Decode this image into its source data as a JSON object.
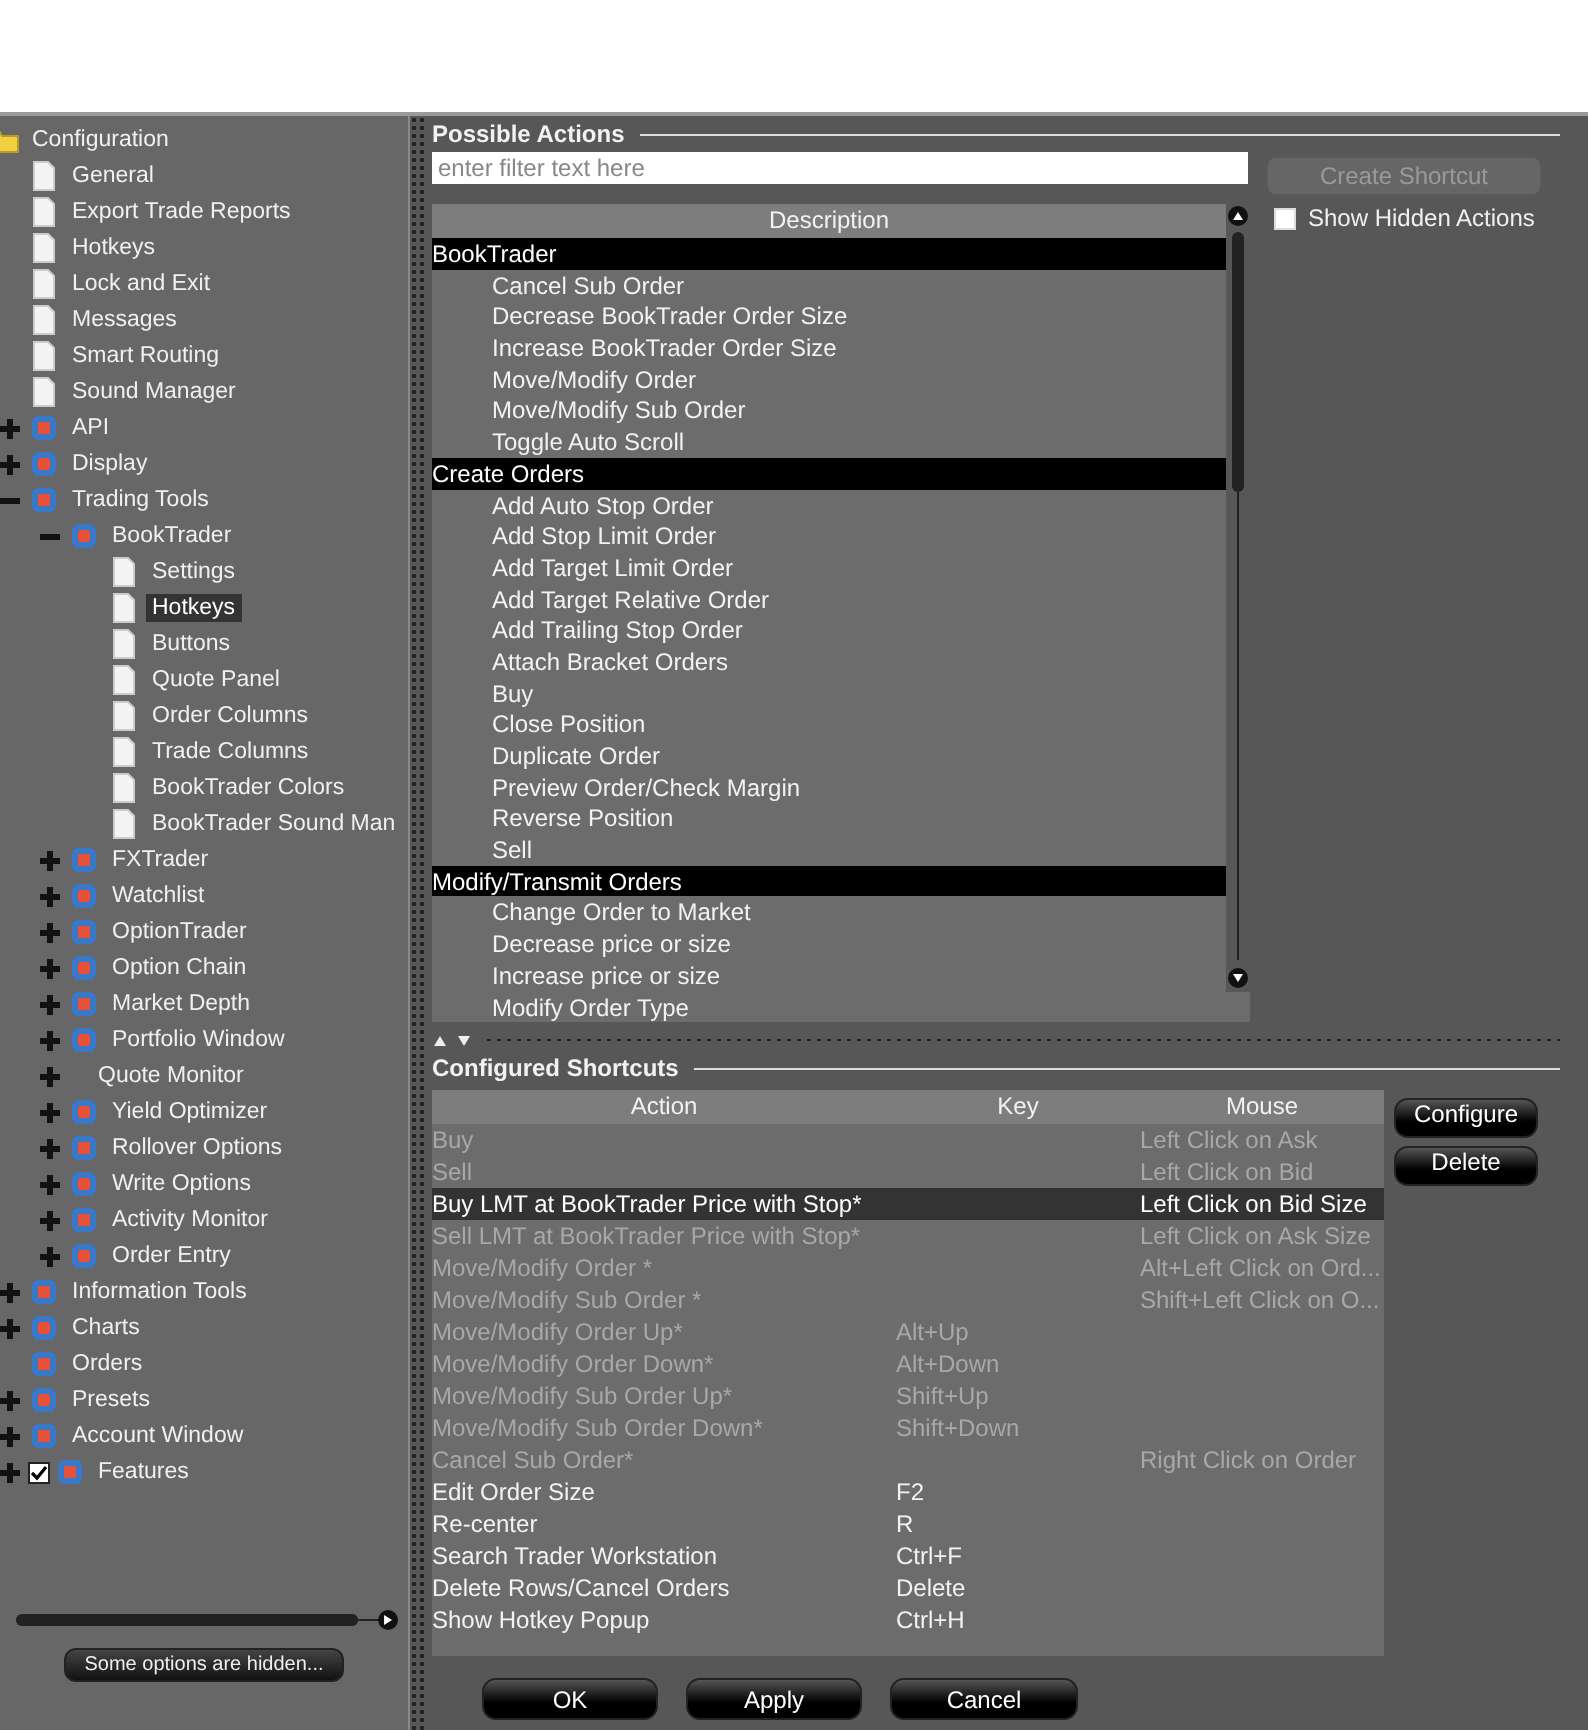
{
  "tree": {
    "items": [
      {
        "label": "Configuration",
        "kind": "folder",
        "selected": false,
        "children": [
          {
            "label": "General",
            "kind": "page",
            "selected": false
          },
          {
            "label": "Export Trade Reports",
            "kind": "page",
            "selected": false
          },
          {
            "label": "Hotkeys",
            "kind": "page",
            "selected": false
          },
          {
            "label": "Lock and Exit",
            "kind": "page",
            "selected": false
          },
          {
            "label": "Messages",
            "kind": "page",
            "selected": false
          },
          {
            "label": "Smart Routing",
            "kind": "page",
            "selected": false
          },
          {
            "label": "Sound Manager",
            "kind": "page",
            "selected": false
          },
          {
            "label": "API",
            "kind": "app",
            "expanded": false,
            "selected": false
          },
          {
            "label": "Display",
            "kind": "app",
            "expanded": false,
            "selected": false
          },
          {
            "label": "Trading Tools",
            "kind": "app",
            "expanded": true,
            "selected": false,
            "children": [
              {
                "label": "BookTrader",
                "kind": "app",
                "expanded": true,
                "selected": false,
                "children": [
                  {
                    "label": "Settings",
                    "kind": "page",
                    "selected": false
                  },
                  {
                    "label": "Hotkeys",
                    "kind": "page",
                    "selected": true
                  },
                  {
                    "label": "Buttons",
                    "kind": "page",
                    "selected": false
                  },
                  {
                    "label": "Quote Panel",
                    "kind": "page",
                    "selected": false
                  },
                  {
                    "label": "Order Columns",
                    "kind": "page",
                    "selected": false
                  },
                  {
                    "label": "Trade Columns",
                    "kind": "page",
                    "selected": false
                  },
                  {
                    "label": "BookTrader Colors",
                    "kind": "page",
                    "selected": false
                  },
                  {
                    "label": "BookTrader Sound Man",
                    "kind": "page",
                    "selected": false
                  }
                ]
              },
              {
                "label": "FXTrader",
                "kind": "app",
                "expanded": false,
                "selected": false
              },
              {
                "label": "Watchlist",
                "kind": "app",
                "expanded": false,
                "selected": false
              },
              {
                "label": "OptionTrader",
                "kind": "app",
                "expanded": false,
                "selected": false
              },
              {
                "label": "Option Chain",
                "kind": "app",
                "expanded": false,
                "selected": false
              },
              {
                "label": "Market Depth",
                "kind": "app",
                "expanded": false,
                "selected": false
              },
              {
                "label": "Portfolio Window",
                "kind": "app",
                "expanded": false,
                "selected": false
              },
              {
                "label": "Quote Monitor",
                "kind": "none",
                "expanded": false,
                "selected": false
              },
              {
                "label": "Yield Optimizer",
                "kind": "app",
                "expanded": false,
                "selected": false
              },
              {
                "label": "Rollover Options",
                "kind": "app",
                "expanded": false,
                "selected": false
              },
              {
                "label": "Write Options",
                "kind": "app",
                "expanded": false,
                "selected": false
              },
              {
                "label": "Activity Monitor",
                "kind": "app",
                "expanded": false,
                "selected": false
              },
              {
                "label": "Order Entry",
                "kind": "app",
                "expanded": false,
                "selected": false
              }
            ]
          },
          {
            "label": "Information Tools",
            "kind": "app",
            "expanded": false,
            "selected": false
          },
          {
            "label": "Charts",
            "kind": "app",
            "expanded": false,
            "selected": false
          },
          {
            "label": "Orders",
            "kind": "app",
            "selected": false
          },
          {
            "label": "Presets",
            "kind": "app",
            "expanded": false,
            "selected": false
          },
          {
            "label": "Account Window",
            "kind": "app",
            "expanded": false,
            "selected": false
          },
          {
            "label": "Features",
            "kind": "app",
            "expanded": false,
            "checked": true,
            "selected": false
          }
        ]
      }
    ]
  },
  "hidden_notice": "Some options are hidden...",
  "possible_actions": {
    "title": "Possible Actions",
    "filter": {
      "placeholder": "enter filter text here"
    },
    "create_button": {
      "label": "Create Shortcut",
      "disabled": true
    },
    "show_hidden": {
      "label": "Show Hidden Actions",
      "checked": false
    },
    "column": "Description",
    "rows": [
      {
        "kind": "group",
        "label": "BookTrader"
      },
      {
        "kind": "action",
        "label": "Cancel Sub Order"
      },
      {
        "kind": "action",
        "label": "Decrease BookTrader Order Size"
      },
      {
        "kind": "action",
        "label": "Increase BookTrader Order Size"
      },
      {
        "kind": "action",
        "label": "Move/Modify Order"
      },
      {
        "kind": "action",
        "label": "Move/Modify Sub Order"
      },
      {
        "kind": "action",
        "label": "Toggle Auto Scroll"
      },
      {
        "kind": "group",
        "label": "Create Orders"
      },
      {
        "kind": "action",
        "label": "Add Auto Stop Order"
      },
      {
        "kind": "action",
        "label": "Add Stop Limit Order"
      },
      {
        "kind": "action",
        "label": "Add Target Limit Order"
      },
      {
        "kind": "action",
        "label": "Add Target Relative Order"
      },
      {
        "kind": "action",
        "label": "Add Trailing Stop Order"
      },
      {
        "kind": "action",
        "label": "Attach Bracket Orders"
      },
      {
        "kind": "action",
        "label": "Buy"
      },
      {
        "kind": "action",
        "label": "Close Position"
      },
      {
        "kind": "action",
        "label": "Duplicate Order"
      },
      {
        "kind": "action",
        "label": "Preview Order/Check Margin"
      },
      {
        "kind": "action",
        "label": "Reverse Position"
      },
      {
        "kind": "action",
        "label": "Sell"
      },
      {
        "kind": "group",
        "label": "Modify/Transmit Orders"
      },
      {
        "kind": "action",
        "label": "Change Order to Market"
      },
      {
        "kind": "action",
        "label": "Decrease price or size"
      },
      {
        "kind": "action",
        "label": "Increase price or size"
      },
      {
        "kind": "action",
        "label": "Modify Order Type"
      }
    ]
  },
  "configured_shortcuts": {
    "title": "Configured Shortcuts",
    "columns": [
      "Action",
      "Key",
      "Mouse"
    ],
    "rows": [
      {
        "action": "Buy",
        "mouse": "Left Click on Ask",
        "disabled": true,
        "selected": false
      },
      {
        "action": "Sell",
        "mouse": "Left Click on Bid",
        "disabled": true,
        "selected": false
      },
      {
        "action": "Buy LMT at BookTrader Price with Stop*",
        "mouse": "Left Click on Bid Size",
        "disabled": true,
        "selected": true
      },
      {
        "action": "Sell LMT at BookTrader Price with Stop*",
        "mouse": "Left Click on Ask Size",
        "disabled": true,
        "selected": false
      },
      {
        "action": "Move/Modify Order *",
        "mouse": "Alt+Left Click on Ord...",
        "disabled": true,
        "selected": false
      },
      {
        "action": "Move/Modify Sub Order *",
        "mouse": "Shift+Left Click on O...",
        "disabled": true,
        "selected": false
      },
      {
        "action": "Move/Modify Order Up*",
        "key": "Alt+Up",
        "disabled": true,
        "selected": false
      },
      {
        "action": "Move/Modify Order Down*",
        "key": "Alt+Down",
        "disabled": true,
        "selected": false
      },
      {
        "action": "Move/Modify Sub Order Up*",
        "key": "Shift+Up",
        "disabled": true,
        "selected": false
      },
      {
        "action": "Move/Modify Sub Order Down*",
        "key": "Shift+Down",
        "disabled": true,
        "selected": false
      },
      {
        "action": "Cancel Sub Order*",
        "mouse": "Right Click on Order",
        "disabled": true,
        "selected": false
      },
      {
        "action": "Edit Order Size",
        "key": "F2",
        "disabled": false,
        "selected": false
      },
      {
        "action": "Re-center",
        "key": "R",
        "disabled": false,
        "selected": false
      },
      {
        "action": "Search Trader Workstation",
        "key": "Ctrl+F",
        "disabled": false,
        "selected": false
      },
      {
        "action": "Delete Rows/Cancel Orders",
        "key": "Delete",
        "disabled": false,
        "selected": false
      },
      {
        "action": "Show Hotkey Popup",
        "key": "Ctrl+H",
        "disabled": false,
        "selected": false
      }
    ],
    "buttons": [
      "Configure",
      "Delete"
    ]
  },
  "footer_buttons": [
    "OK",
    "Apply",
    "Cancel"
  ]
}
